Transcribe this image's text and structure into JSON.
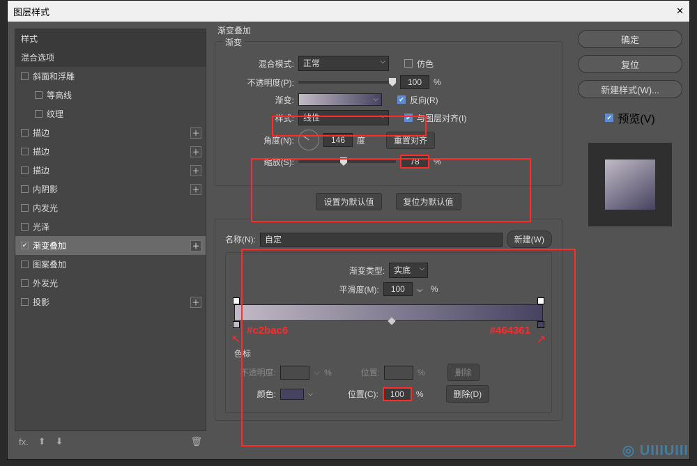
{
  "title": "图层样式",
  "sidebar": {
    "header1": "样式",
    "header2": "混合选项",
    "items": [
      {
        "label": "斜面和浮雕",
        "checked": false,
        "indent": false,
        "plus": false
      },
      {
        "label": "等高线",
        "checked": false,
        "indent": true,
        "plus": false
      },
      {
        "label": "纹理",
        "checked": false,
        "indent": true,
        "plus": false
      },
      {
        "label": "描边",
        "checked": false,
        "indent": false,
        "plus": true
      },
      {
        "label": "描边",
        "checked": false,
        "indent": false,
        "plus": true
      },
      {
        "label": "描边",
        "checked": false,
        "indent": false,
        "plus": true
      },
      {
        "label": "内阴影",
        "checked": false,
        "indent": false,
        "plus": true
      },
      {
        "label": "内发光",
        "checked": false,
        "indent": false,
        "plus": false
      },
      {
        "label": "光泽",
        "checked": false,
        "indent": false,
        "plus": false
      },
      {
        "label": "渐变叠加",
        "checked": true,
        "indent": false,
        "plus": true,
        "selected": true
      },
      {
        "label": "图案叠加",
        "checked": false,
        "indent": false,
        "plus": false
      },
      {
        "label": "外发光",
        "checked": false,
        "indent": false,
        "plus": false
      },
      {
        "label": "投影",
        "checked": false,
        "indent": false,
        "plus": true
      }
    ]
  },
  "overlay": {
    "section": "渐变叠加",
    "subsection": "渐变",
    "blendLabel": "混合模式:",
    "blendValue": "正常",
    "ditherLabel": "仿色",
    "opacityLabel": "不透明度(P):",
    "opacityValue": "100",
    "pct": "%",
    "gradLabel": "渐变:",
    "reverseLabel": "反向(R)",
    "styleLabel": "样式:",
    "styleValue": "线性",
    "alignLabel": "与图层对齐(I)",
    "angleLabel": "角度(N):",
    "angleValue": "146",
    "angleUnit": "度",
    "resetAlign": "重置对齐",
    "scaleLabel": "缩放(S):",
    "scaleValue": "78",
    "makeDefault": "设置为默认值",
    "resetDefault": "复位为默认值"
  },
  "editor": {
    "nameLabel": "名称(N):",
    "nameValue": "自定",
    "newBtn": "新建(W)",
    "typeLabel": "渐变类型:",
    "typeValue": "实底",
    "smoothLabel": "平滑度(M):",
    "smoothValue": "100",
    "pct": "%",
    "hexLeft": "#c2bac6",
    "hexRight": "#464361",
    "stopsLabel": "色标",
    "opLabel": "不透明度:",
    "posLabel": "位置:",
    "posLabel2": "位置(C):",
    "posValue": "100",
    "colorLabel": "颜色:",
    "delete": "删除",
    "deleteD": "删除(D)"
  },
  "right": {
    "ok": "确定",
    "cancel": "复位",
    "newStyle": "新建样式(W)...",
    "preview": "预览(V)"
  },
  "watermark": "UIIIUIII"
}
